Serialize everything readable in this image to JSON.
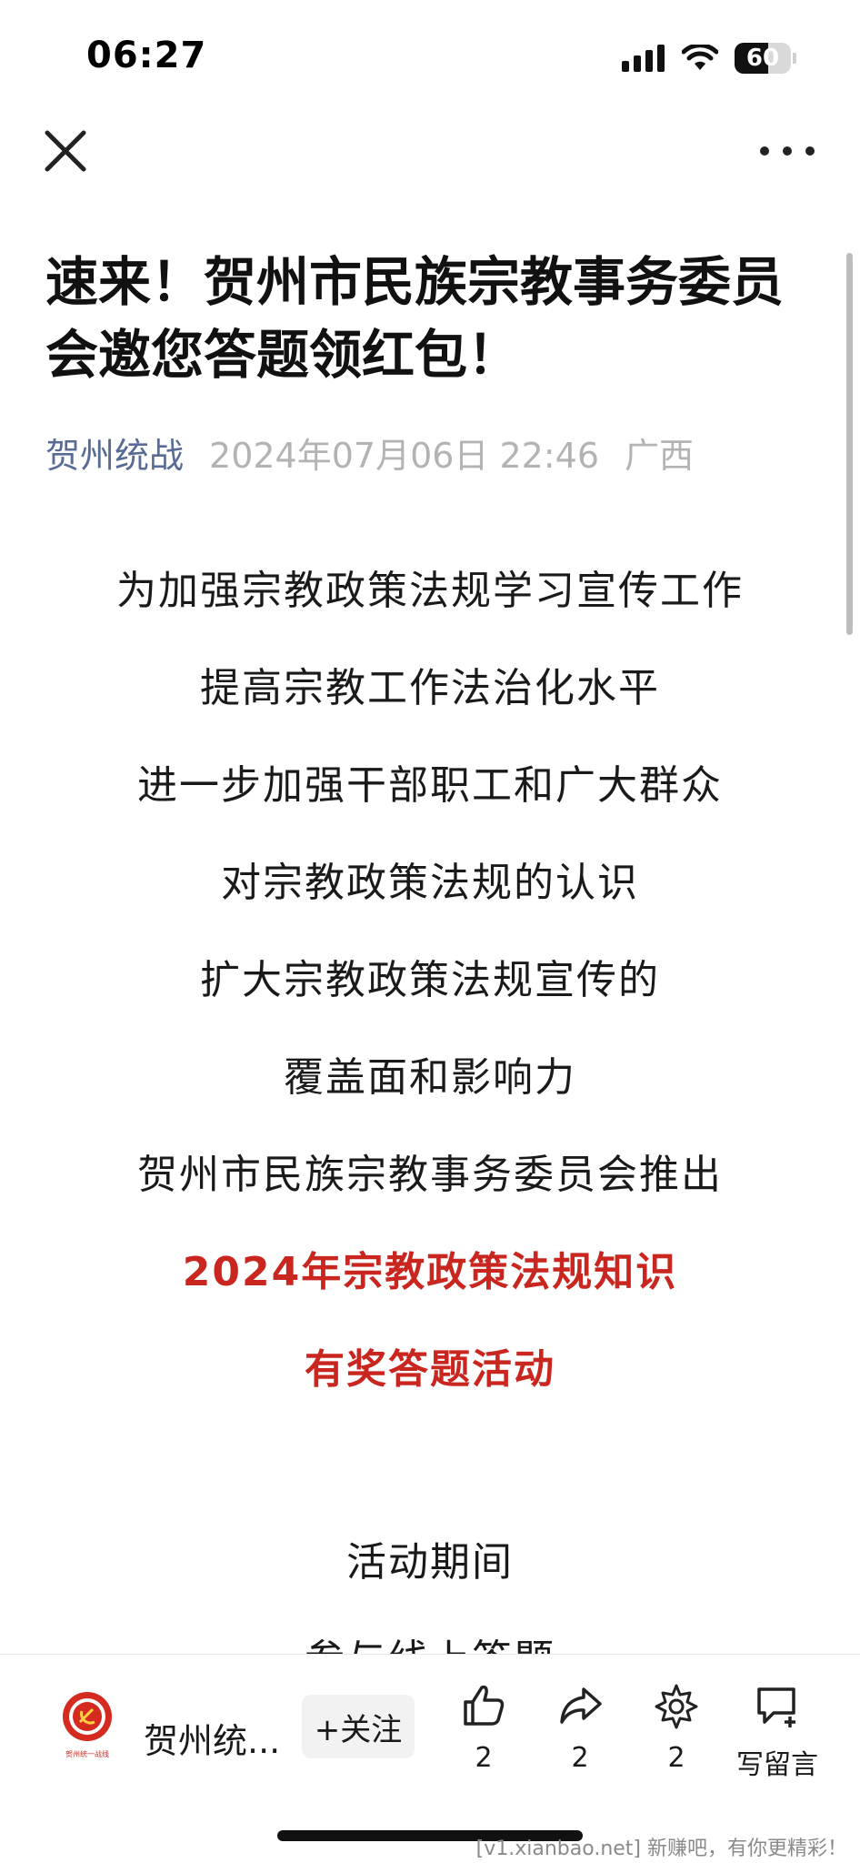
{
  "status_bar": {
    "time": "06:27",
    "battery": "60"
  },
  "nav": {
    "close_icon": "close-icon",
    "more_icon": "more-icon"
  },
  "article": {
    "title": "速来！贺州市民族宗教事务委员会邀您答题领红包！",
    "account": "贺州统战",
    "date": "2024年07月06日 22:46",
    "region": "广西",
    "paragraphs": [
      "为加强宗教政策法规学习宣传工作",
      "提高宗教工作法治化水平",
      "进一步加强干部职工和广大群众",
      "对宗教政策法规的认识",
      "扩大宗教政策法规宣传的",
      "覆盖面和影响力",
      "贺州市民族宗教事务委员会推出"
    ],
    "highlight": [
      "2024年宗教政策法规知识",
      "有奖答题活动"
    ],
    "section_heading": "活动期间",
    "partial_line": "参与线上答题"
  },
  "bottom_bar": {
    "account_name": "贺州统...",
    "logo_text": "贺州统一战线",
    "follow_label": "+关注",
    "like_count": "2",
    "share_count": "2",
    "recommend_count": "2",
    "comment_label": "写留言"
  },
  "watermark": "[v1.xianbao.net] 新赚吧，有你更精彩！",
  "colors": {
    "account_blue": "#576b95",
    "highlight_red": "#c9261f",
    "meta_gray": "#b3b3b3"
  }
}
